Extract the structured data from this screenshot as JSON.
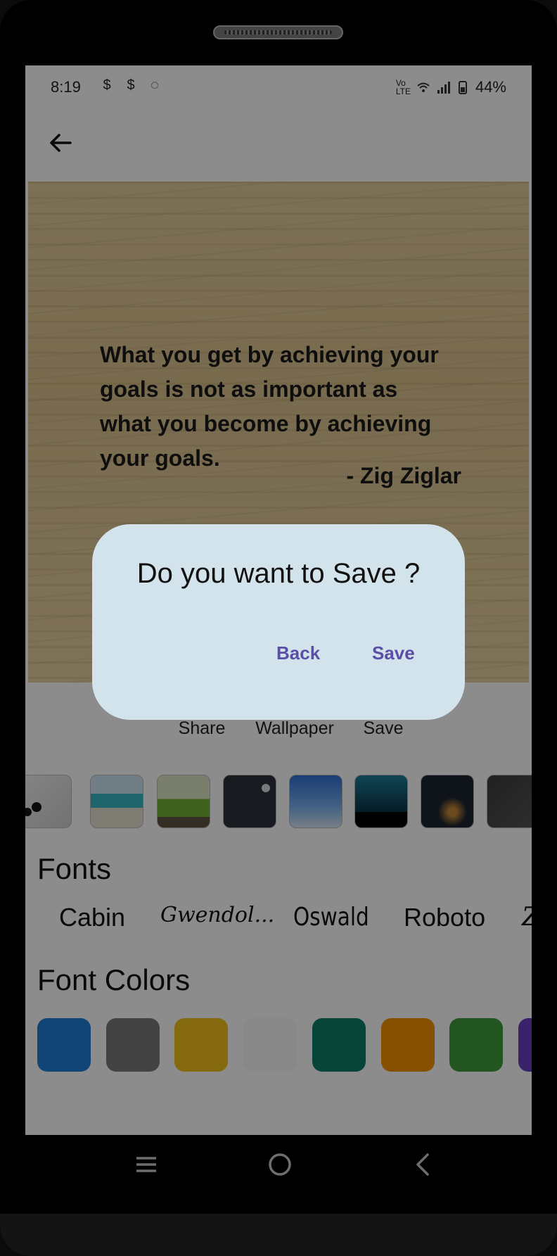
{
  "status_bar": {
    "time": "8:19",
    "battery": "44%",
    "icons": [
      "notification-s-icon",
      "notification-s-icon",
      "whatsapp-icon",
      "volte-icon",
      "wifi-icon",
      "signal-icon",
      "battery-icon"
    ]
  },
  "quote": {
    "text": "What you get by achieving your goals is not as important as what you become by achieving your goals.",
    "author": "- Zig Ziglar"
  },
  "actions": {
    "share": "Share",
    "wallpaper": "Wallpaper",
    "save": "Save"
  },
  "sections": {
    "fonts_title": "Fonts",
    "font_colors_title": "Font Colors"
  },
  "fonts": [
    "Cabin",
    "Gwendol...",
    "Oswald",
    "Roboto"
  ],
  "font_colors": [
    "#1f7fd6",
    "#7a7a7a",
    "#f0c01a",
    "#f8f8f8",
    "#0d7f66",
    "#f39200",
    "#3f9b3b",
    "#6a3fc2"
  ],
  "dialog": {
    "title": "Do you want to Save ?",
    "back_label": "Back",
    "save_label": "Save"
  }
}
